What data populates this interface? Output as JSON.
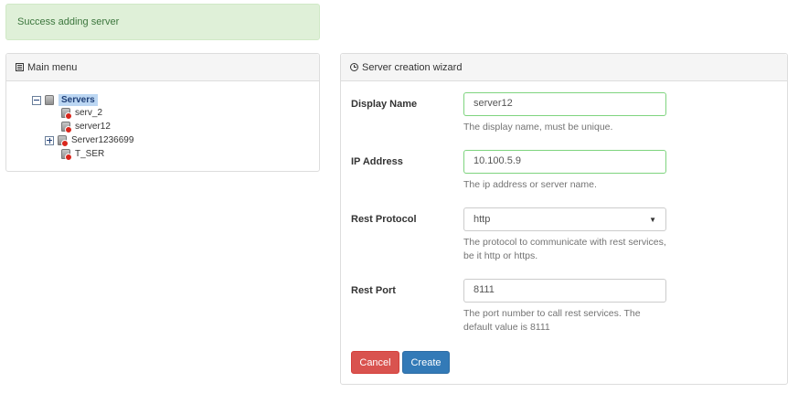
{
  "alert": {
    "message": "Success adding server"
  },
  "menu": {
    "title": "Main menu",
    "icon": "list-icon",
    "tree": {
      "root": "Servers",
      "items": [
        "serv_2",
        "server12",
        "Server1236699",
        "T_SER"
      ]
    }
  },
  "wizard": {
    "title": "Server creation wizard",
    "icon": "clock-icon",
    "fields": {
      "display_name": {
        "label": "Display Name",
        "value": "server12",
        "help": "The display name, must be unique."
      },
      "ip_address": {
        "label": "IP Address",
        "value": "10.100.5.9",
        "help": "The ip address or server name."
      },
      "rest_protocol": {
        "label": "Rest Protocol",
        "value": "http",
        "help": "The protocol to communicate with rest services, be it http or https."
      },
      "rest_port": {
        "label": "Rest Port",
        "value": "8111",
        "help": "The port number to call rest services. The default value is 8111"
      }
    },
    "buttons": {
      "cancel": "Cancel",
      "create": "Create"
    }
  },
  "colors": {
    "success_bg": "#dff0d8",
    "success_text": "#3c763d",
    "danger": "#d9534f",
    "primary": "#337ab7",
    "valid_border": "#7fd47f"
  }
}
